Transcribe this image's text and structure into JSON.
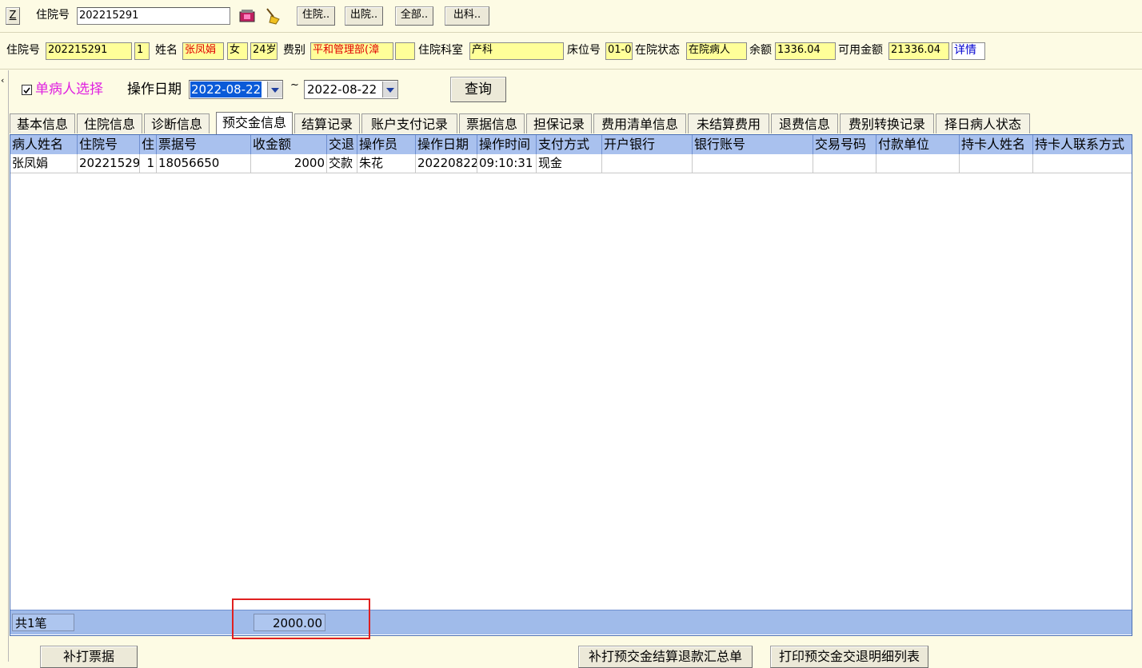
{
  "top": {
    "z_label": "Z",
    "admission_no_label": "住院号",
    "admission_no_value": "202215291",
    "btn_inpatient": "住院..",
    "btn_discharge": "出院..",
    "btn_all": "全部..",
    "btn_out_dept": "出科.."
  },
  "patient": {
    "admission_no_label": "住院号",
    "admission_no": "202215291",
    "times": "1",
    "name_label": "姓名",
    "name": "张凤娟",
    "gender": "女",
    "age": "24岁",
    "fee_type_label": "费别",
    "fee_type": "平和管理部(漳",
    "dept_label": "住院科室",
    "dept": "产科",
    "bed_label": "床位号",
    "bed": "01-0",
    "status_label": "在院状态",
    "status": "在院病人",
    "balance_label": "余额",
    "balance": "1336.04",
    "available_label": "可用金额",
    "available": "21336.04",
    "detail_link": "详情"
  },
  "filter": {
    "single_patient_label": "单病人选择",
    "op_date_label": "操作日期",
    "date_from": "2022-08-22",
    "tilde": "~",
    "date_to": "2022-08-22",
    "query_button": "查询"
  },
  "tabs": [
    "基本信息",
    "住院信息",
    "诊断信息",
    "预交金信息",
    "结算记录",
    "账户支付记录",
    "票据信息",
    "担保记录",
    "费用清单信息",
    "未结算费用",
    "退费信息",
    "费别转换记录",
    "择日病人状态"
  ],
  "table": {
    "headers": [
      "病人姓名",
      "住院号",
      "住",
      "票据号",
      "收金额",
      "交退",
      "操作员",
      "操作日期",
      "操作时间",
      "支付方式",
      "开户银行",
      "银行账号",
      "交易号码",
      "付款单位",
      "持卡人姓名",
      "持卡人联系方式"
    ],
    "rows": [
      [
        "张凤娟",
        "20221529",
        "1",
        "18056650",
        "2000",
        "交款",
        "朱花",
        "20220822",
        "09:10:31",
        "现金",
        "",
        "",
        "",
        "",
        "",
        ""
      ]
    ]
  },
  "footer": {
    "count": "共1笔",
    "total": "2000.00"
  },
  "bottom": {
    "btn_reprint": "补打票据",
    "btn_reprint_summary": "补打预交金结算退款汇总单",
    "btn_print_list": "打印预交金交退明细列表"
  },
  "colors": {
    "background": "#fdfbe4",
    "field_yellow": "#ffff99",
    "grid_header": "#a9c1ee",
    "highlight_red": "#e02020"
  }
}
